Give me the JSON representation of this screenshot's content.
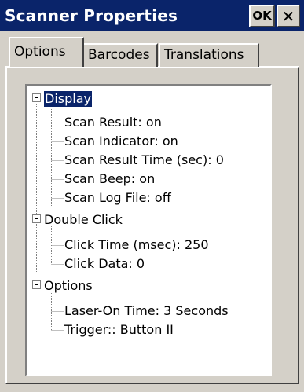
{
  "window": {
    "title": "Scanner Properties",
    "ok_label": "OK",
    "close_label": "✕"
  },
  "tabs": [
    {
      "label": "Options",
      "active": true
    },
    {
      "label": "Barcodes",
      "active": false
    },
    {
      "label": "Translations",
      "active": false
    }
  ],
  "tree": {
    "groups": [
      {
        "label": "Display",
        "expanded": true,
        "selected": true,
        "items": [
          "Scan Result: on",
          "Scan Indicator: on",
          "Scan Result Time (sec): 0",
          "Scan Beep: on",
          "Scan Log File: off"
        ]
      },
      {
        "label": "Double Click",
        "expanded": true,
        "selected": false,
        "items": [
          "Click Time (msec): 250",
          "Click Data: 0"
        ]
      },
      {
        "label": "Options",
        "expanded": true,
        "selected": false,
        "items": [
          "Laser-On Time: 3 Seconds",
          "Trigger:: Button II"
        ]
      }
    ]
  },
  "colors": {
    "titlebar": "#0a246a",
    "face": "#d4d0c8",
    "selection": "#0a246a"
  }
}
